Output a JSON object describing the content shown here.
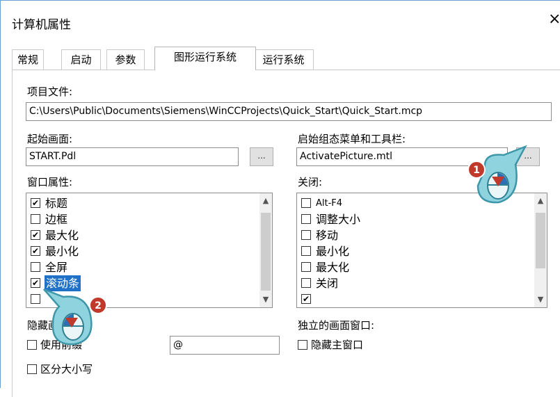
{
  "window": {
    "title": "计算机属性",
    "close_glyph": "×"
  },
  "tabs": [
    {
      "label": "常规"
    },
    {
      "label": "启动"
    },
    {
      "label": "参数"
    },
    {
      "label": "图形运行系统",
      "active": true
    },
    {
      "label": "运行系统"
    }
  ],
  "project_file": {
    "label": "项目文件:",
    "value": "C:\\Users\\Public\\Documents\\Siemens\\WinCCProjects\\Quick_Start\\Quick_Start.mcp"
  },
  "start_screen": {
    "label": "起始画面:",
    "value": "START.Pdl",
    "browse": "..."
  },
  "start_menu": {
    "label": "启始组态菜单和工具栏:",
    "value": "ActivatePicture.mtl",
    "browse": "..."
  },
  "window_attributes": {
    "label": "窗口属性:",
    "items": [
      {
        "label": "标题",
        "checked": true
      },
      {
        "label": "边框",
        "checked": false
      },
      {
        "label": "最大化",
        "checked": true
      },
      {
        "label": "最小化",
        "checked": true
      },
      {
        "label": "全屏",
        "checked": false
      },
      {
        "label": "滚动条",
        "checked": true,
        "selected": true
      }
    ]
  },
  "close_options": {
    "label": "关闭:",
    "items": [
      {
        "label": "Alt-F4",
        "checked": false
      },
      {
        "label": "调整大小",
        "checked": false
      },
      {
        "label": "移动",
        "checked": false
      },
      {
        "label": "最小化",
        "checked": false
      },
      {
        "label": "最大化",
        "checked": false
      },
      {
        "label": "关闭",
        "checked": false
      }
    ]
  },
  "hidden_screens": {
    "label": "隐藏画面:",
    "use_prefix_label": "使用前缀",
    "prefix_value": "@",
    "case_sensitive_label": "区分大小写"
  },
  "independent_window": {
    "label": "独立的画面窗口:",
    "hide_main_label": "隐藏主窗口"
  },
  "callouts": [
    {
      "number": "1"
    },
    {
      "number": "2"
    }
  ],
  "colors": {
    "selection": "#1f72c8",
    "callout_fill": "#8fd3df",
    "callout_stroke": "#3e97a8",
    "badge": "#c0392b"
  }
}
